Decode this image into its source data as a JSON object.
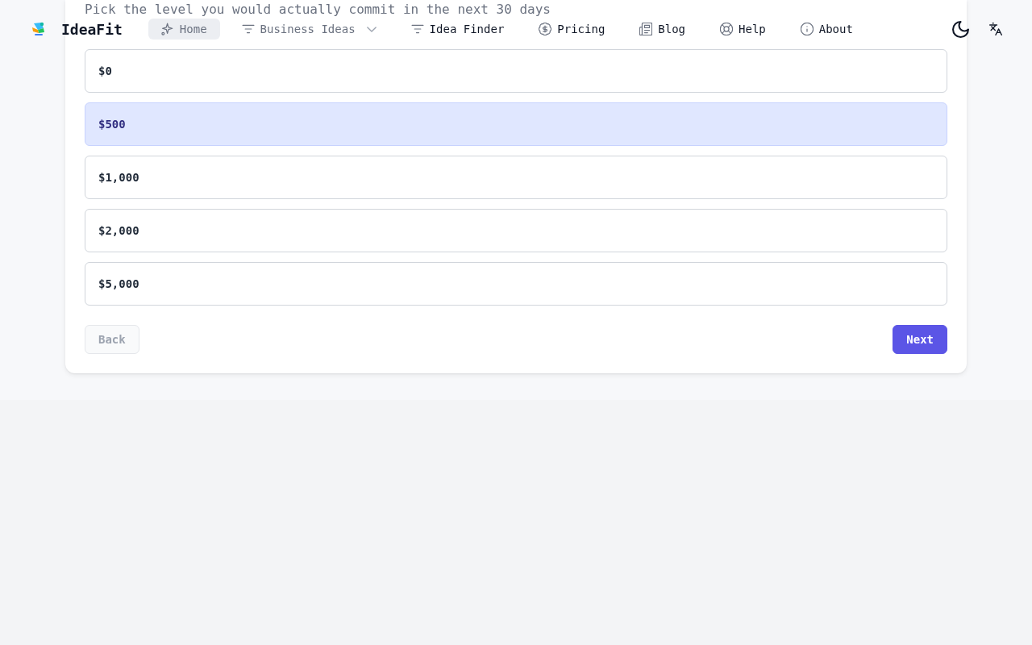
{
  "header": {
    "brand": "IdeaFit",
    "nav": [
      {
        "label": "Home",
        "kind": "link",
        "selected": true,
        "dimmed": true
      },
      {
        "label": "Business Ideas",
        "kind": "dropdown",
        "selected": false,
        "dimmed": true
      },
      {
        "label": "Idea Finder",
        "kind": "link",
        "selected": false,
        "dimmed": false
      },
      {
        "label": "Pricing",
        "kind": "link",
        "selected": false,
        "dimmed": false
      },
      {
        "label": "Blog",
        "kind": "link",
        "selected": false,
        "dimmed": false
      },
      {
        "label": "Help",
        "kind": "link",
        "selected": false,
        "dimmed": false
      },
      {
        "label": "About",
        "kind": "link",
        "selected": false,
        "dimmed": false
      }
    ]
  },
  "question": {
    "subtitle": "Pick the level you would actually commit in the next 30 days",
    "options": [
      {
        "label": "$0",
        "selected": false
      },
      {
        "label": "$500",
        "selected": true
      },
      {
        "label": "$1,000",
        "selected": false
      },
      {
        "label": "$2,000",
        "selected": false
      },
      {
        "label": "$5,000",
        "selected": false
      }
    ],
    "back": {
      "label": "Back",
      "disabled": true
    },
    "next": {
      "label": "Next",
      "disabled": false
    }
  }
}
